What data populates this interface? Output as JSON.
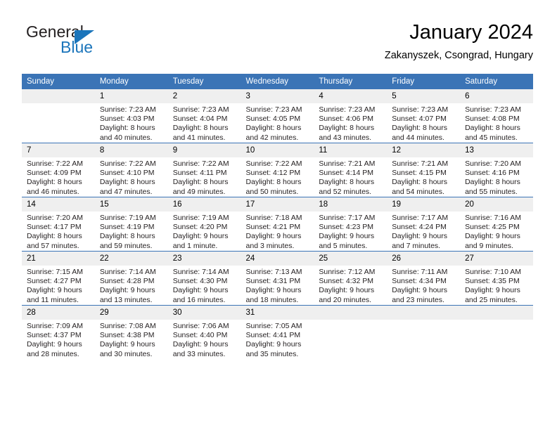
{
  "logo": {
    "text_primary": "General",
    "text_secondary": "Blue",
    "primary_color": "#231f20",
    "secondary_color": "#1b75bb"
  },
  "header": {
    "title": "January 2024",
    "subtitle": "Zakanyszek, Csongrad, Hungary"
  },
  "theme": {
    "header_blue": "#3b74b6",
    "daynum_band": "#efefef",
    "text": "#231f20"
  },
  "weekdays": [
    "Sunday",
    "Monday",
    "Tuesday",
    "Wednesday",
    "Thursday",
    "Friday",
    "Saturday"
  ],
  "weeks": [
    [
      {
        "day": "",
        "blank": true,
        "sunrise": "",
        "sunset": "",
        "daylight1": "",
        "daylight2": ""
      },
      {
        "day": "1",
        "blank": false,
        "sunrise": "Sunrise: 7:23 AM",
        "sunset": "Sunset: 4:03 PM",
        "daylight1": "Daylight: 8 hours",
        "daylight2": "and 40 minutes."
      },
      {
        "day": "2",
        "blank": false,
        "sunrise": "Sunrise: 7:23 AM",
        "sunset": "Sunset: 4:04 PM",
        "daylight1": "Daylight: 8 hours",
        "daylight2": "and 41 minutes."
      },
      {
        "day": "3",
        "blank": false,
        "sunrise": "Sunrise: 7:23 AM",
        "sunset": "Sunset: 4:05 PM",
        "daylight1": "Daylight: 8 hours",
        "daylight2": "and 42 minutes."
      },
      {
        "day": "4",
        "blank": false,
        "sunrise": "Sunrise: 7:23 AM",
        "sunset": "Sunset: 4:06 PM",
        "daylight1": "Daylight: 8 hours",
        "daylight2": "and 43 minutes."
      },
      {
        "day": "5",
        "blank": false,
        "sunrise": "Sunrise: 7:23 AM",
        "sunset": "Sunset: 4:07 PM",
        "daylight1": "Daylight: 8 hours",
        "daylight2": "and 44 minutes."
      },
      {
        "day": "6",
        "blank": false,
        "sunrise": "Sunrise: 7:23 AM",
        "sunset": "Sunset: 4:08 PM",
        "daylight1": "Daylight: 8 hours",
        "daylight2": "and 45 minutes."
      }
    ],
    [
      {
        "day": "7",
        "blank": false,
        "sunrise": "Sunrise: 7:22 AM",
        "sunset": "Sunset: 4:09 PM",
        "daylight1": "Daylight: 8 hours",
        "daylight2": "and 46 minutes."
      },
      {
        "day": "8",
        "blank": false,
        "sunrise": "Sunrise: 7:22 AM",
        "sunset": "Sunset: 4:10 PM",
        "daylight1": "Daylight: 8 hours",
        "daylight2": "and 47 minutes."
      },
      {
        "day": "9",
        "blank": false,
        "sunrise": "Sunrise: 7:22 AM",
        "sunset": "Sunset: 4:11 PM",
        "daylight1": "Daylight: 8 hours",
        "daylight2": "and 49 minutes."
      },
      {
        "day": "10",
        "blank": false,
        "sunrise": "Sunrise: 7:22 AM",
        "sunset": "Sunset: 4:12 PM",
        "daylight1": "Daylight: 8 hours",
        "daylight2": "and 50 minutes."
      },
      {
        "day": "11",
        "blank": false,
        "sunrise": "Sunrise: 7:21 AM",
        "sunset": "Sunset: 4:14 PM",
        "daylight1": "Daylight: 8 hours",
        "daylight2": "and 52 minutes."
      },
      {
        "day": "12",
        "blank": false,
        "sunrise": "Sunrise: 7:21 AM",
        "sunset": "Sunset: 4:15 PM",
        "daylight1": "Daylight: 8 hours",
        "daylight2": "and 54 minutes."
      },
      {
        "day": "13",
        "blank": false,
        "sunrise": "Sunrise: 7:20 AM",
        "sunset": "Sunset: 4:16 PM",
        "daylight1": "Daylight: 8 hours",
        "daylight2": "and 55 minutes."
      }
    ],
    [
      {
        "day": "14",
        "blank": false,
        "sunrise": "Sunrise: 7:20 AM",
        "sunset": "Sunset: 4:17 PM",
        "daylight1": "Daylight: 8 hours",
        "daylight2": "and 57 minutes."
      },
      {
        "day": "15",
        "blank": false,
        "sunrise": "Sunrise: 7:19 AM",
        "sunset": "Sunset: 4:19 PM",
        "daylight1": "Daylight: 8 hours",
        "daylight2": "and 59 minutes."
      },
      {
        "day": "16",
        "blank": false,
        "sunrise": "Sunrise: 7:19 AM",
        "sunset": "Sunset: 4:20 PM",
        "daylight1": "Daylight: 9 hours",
        "daylight2": "and 1 minute."
      },
      {
        "day": "17",
        "blank": false,
        "sunrise": "Sunrise: 7:18 AM",
        "sunset": "Sunset: 4:21 PM",
        "daylight1": "Daylight: 9 hours",
        "daylight2": "and 3 minutes."
      },
      {
        "day": "18",
        "blank": false,
        "sunrise": "Sunrise: 7:17 AM",
        "sunset": "Sunset: 4:23 PM",
        "daylight1": "Daylight: 9 hours",
        "daylight2": "and 5 minutes."
      },
      {
        "day": "19",
        "blank": false,
        "sunrise": "Sunrise: 7:17 AM",
        "sunset": "Sunset: 4:24 PM",
        "daylight1": "Daylight: 9 hours",
        "daylight2": "and 7 minutes."
      },
      {
        "day": "20",
        "blank": false,
        "sunrise": "Sunrise: 7:16 AM",
        "sunset": "Sunset: 4:25 PM",
        "daylight1": "Daylight: 9 hours",
        "daylight2": "and 9 minutes."
      }
    ],
    [
      {
        "day": "21",
        "blank": false,
        "sunrise": "Sunrise: 7:15 AM",
        "sunset": "Sunset: 4:27 PM",
        "daylight1": "Daylight: 9 hours",
        "daylight2": "and 11 minutes."
      },
      {
        "day": "22",
        "blank": false,
        "sunrise": "Sunrise: 7:14 AM",
        "sunset": "Sunset: 4:28 PM",
        "daylight1": "Daylight: 9 hours",
        "daylight2": "and 13 minutes."
      },
      {
        "day": "23",
        "blank": false,
        "sunrise": "Sunrise: 7:14 AM",
        "sunset": "Sunset: 4:30 PM",
        "daylight1": "Daylight: 9 hours",
        "daylight2": "and 16 minutes."
      },
      {
        "day": "24",
        "blank": false,
        "sunrise": "Sunrise: 7:13 AM",
        "sunset": "Sunset: 4:31 PM",
        "daylight1": "Daylight: 9 hours",
        "daylight2": "and 18 minutes."
      },
      {
        "day": "25",
        "blank": false,
        "sunrise": "Sunrise: 7:12 AM",
        "sunset": "Sunset: 4:32 PM",
        "daylight1": "Daylight: 9 hours",
        "daylight2": "and 20 minutes."
      },
      {
        "day": "26",
        "blank": false,
        "sunrise": "Sunrise: 7:11 AM",
        "sunset": "Sunset: 4:34 PM",
        "daylight1": "Daylight: 9 hours",
        "daylight2": "and 23 minutes."
      },
      {
        "day": "27",
        "blank": false,
        "sunrise": "Sunrise: 7:10 AM",
        "sunset": "Sunset: 4:35 PM",
        "daylight1": "Daylight: 9 hours",
        "daylight2": "and 25 minutes."
      }
    ],
    [
      {
        "day": "28",
        "blank": false,
        "sunrise": "Sunrise: 7:09 AM",
        "sunset": "Sunset: 4:37 PM",
        "daylight1": "Daylight: 9 hours",
        "daylight2": "and 28 minutes."
      },
      {
        "day": "29",
        "blank": false,
        "sunrise": "Sunrise: 7:08 AM",
        "sunset": "Sunset: 4:38 PM",
        "daylight1": "Daylight: 9 hours",
        "daylight2": "and 30 minutes."
      },
      {
        "day": "30",
        "blank": false,
        "sunrise": "Sunrise: 7:06 AM",
        "sunset": "Sunset: 4:40 PM",
        "daylight1": "Daylight: 9 hours",
        "daylight2": "and 33 minutes."
      },
      {
        "day": "31",
        "blank": false,
        "sunrise": "Sunrise: 7:05 AM",
        "sunset": "Sunset: 4:41 PM",
        "daylight1": "Daylight: 9 hours",
        "daylight2": "and 35 minutes."
      },
      {
        "day": "",
        "blank": true,
        "sunrise": "",
        "sunset": "",
        "daylight1": "",
        "daylight2": ""
      },
      {
        "day": "",
        "blank": true,
        "sunrise": "",
        "sunset": "",
        "daylight1": "",
        "daylight2": ""
      },
      {
        "day": "",
        "blank": true,
        "sunrise": "",
        "sunset": "",
        "daylight1": "",
        "daylight2": ""
      }
    ]
  ]
}
